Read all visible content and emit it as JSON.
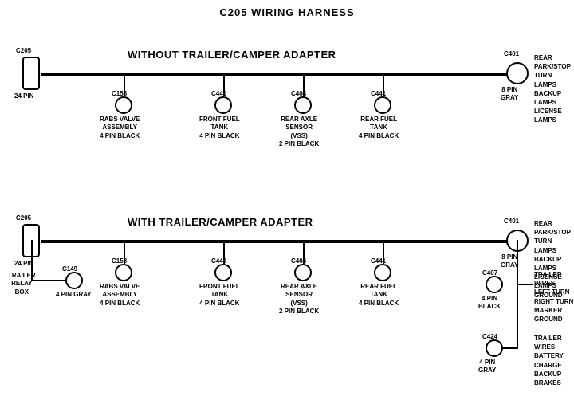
{
  "title": "C205 WIRING HARNESS",
  "section1": {
    "label": "WITHOUT  TRAILER/CAMPER  ADAPTER",
    "connectors": [
      {
        "id": "C205_top",
        "label": "C205",
        "sub": "24 PIN",
        "type": "rect"
      },
      {
        "id": "C158_top",
        "label": "C158",
        "sub": "RABS VALVE\nASSEMBLY\n4 PIN BLACK"
      },
      {
        "id": "C440_top",
        "label": "C440",
        "sub": "FRONT FUEL\nTANK\n4 PIN BLACK"
      },
      {
        "id": "C404_top",
        "label": "C404",
        "sub": "REAR AXLE\nSENSOR\n(VSS)\n2 PIN BLACK"
      },
      {
        "id": "C441_top",
        "label": "C441",
        "sub": "REAR FUEL\nTANK\n4 PIN BLACK"
      },
      {
        "id": "C401_top",
        "label": "C401",
        "sub": "8 PIN\nGRAY",
        "right_label": "REAR PARK/STOP\nTURN LAMPS\nBACKUP LAMPS\nLICENSE LAMPS",
        "type": "right"
      }
    ]
  },
  "section2": {
    "label": "WITH  TRAILER/CAMPER  ADAPTER",
    "connectors": [
      {
        "id": "C205_bot",
        "label": "C205",
        "sub": "24 PIN",
        "type": "rect"
      },
      {
        "id": "C149",
        "label": "C149",
        "sub": "4 PIN GRAY",
        "extra": "TRAILER\nRELAY\nBOX"
      },
      {
        "id": "C158_bot",
        "label": "C158",
        "sub": "RABS VALVE\nASSEMBLY\n4 PIN BLACK"
      },
      {
        "id": "C440_bot",
        "label": "C440",
        "sub": "FRONT FUEL\nTANK\n4 PIN BLACK"
      },
      {
        "id": "C404_bot",
        "label": "C404",
        "sub": "REAR AXLE\nSENSOR\n(VSS)\n2 PIN BLACK"
      },
      {
        "id": "C441_bot",
        "label": "C441",
        "sub": "REAR FUEL\nTANK\n4 PIN BLACK"
      },
      {
        "id": "C401_bot",
        "label": "C401",
        "sub": "8 PIN\nGRAY",
        "right_label": "REAR PARK/STOP\nTURN LAMPS\nBACKUP LAMPS\nLICENSE LAMPS\nGROUND",
        "type": "right"
      },
      {
        "id": "C407",
        "label": "C407",
        "sub": "4 PIN\nBLACK",
        "right_label": "TRAILER WIRES\nLEFT TURN\nRIGHT TURN\nMARKER\nGROUND"
      },
      {
        "id": "C424",
        "label": "C424",
        "sub": "4 PIN\nGRAY",
        "right_label": "TRAILER WIRES\nBATTERY CHARGE\nBACKUP\nBRAKES"
      }
    ]
  }
}
